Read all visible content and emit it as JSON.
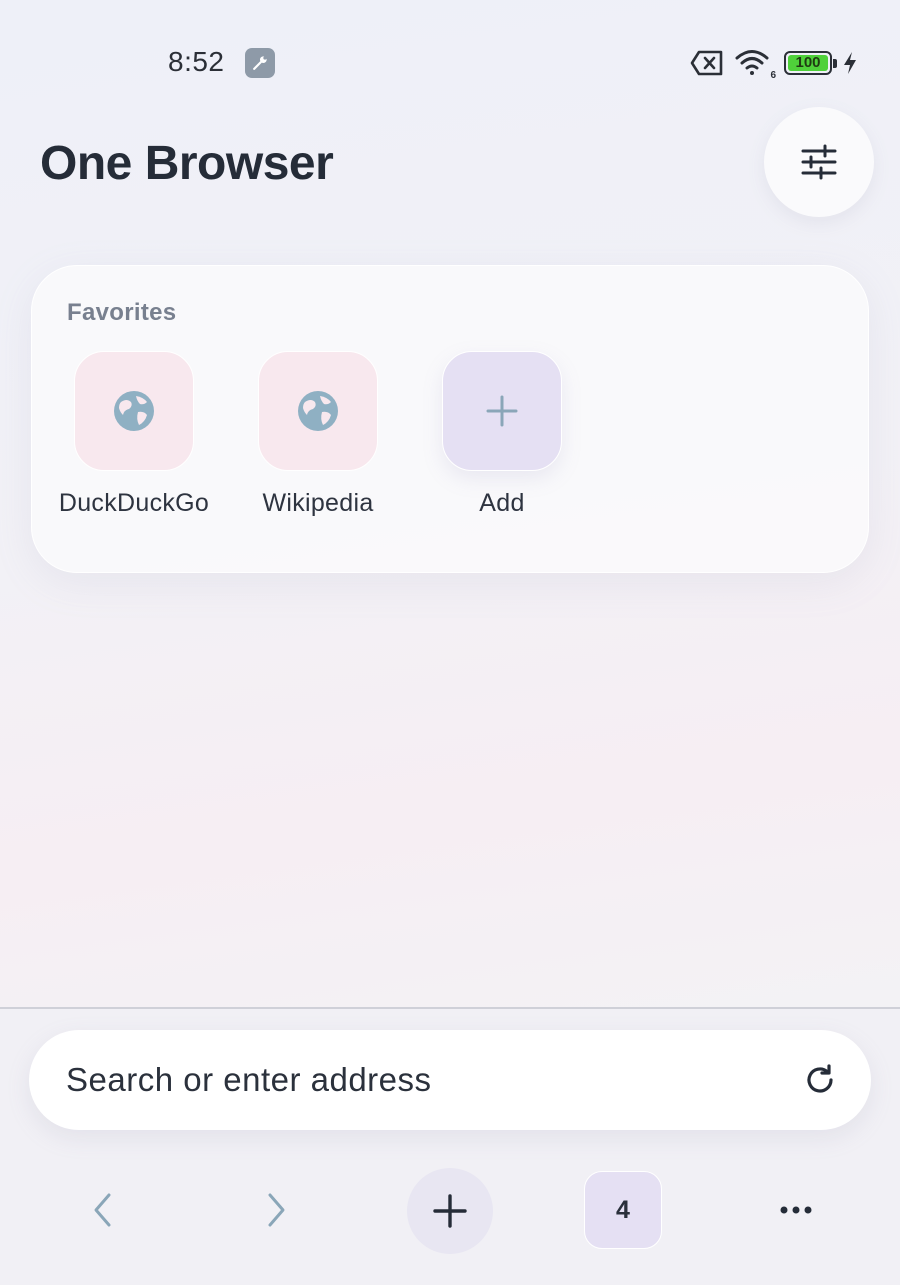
{
  "status_bar": {
    "time": "8:52",
    "battery_level": "100",
    "wifi_standard": "6",
    "icons": [
      "wrench-icon",
      "no-sim-icon",
      "wifi-icon",
      "battery-icon",
      "charging-bolt-icon"
    ],
    "battery_color": "#4fd13a"
  },
  "header": {
    "title": "One Browser",
    "settings_icon": "sliders-icon"
  },
  "favorites": {
    "heading": "Favorites",
    "items": [
      {
        "label": "DuckDuckGo",
        "icon": "globe-icon"
      },
      {
        "label": "Wikipedia",
        "icon": "globe-icon"
      },
      {
        "label": "Add",
        "icon": "plus-icon"
      }
    ]
  },
  "search": {
    "placeholder": "Search or enter address",
    "action_icon": "reload-icon"
  },
  "nav": {
    "back_icon": "chevron-left-icon",
    "forward_icon": "chevron-right-icon",
    "new_tab_icon": "plus-icon",
    "tab_count": "4",
    "menu_icon": "more-horizontal-icon"
  },
  "colors": {
    "title_text": "#252c38",
    "globe_icon": "#8fb0c3",
    "favorite_tile": "#f8e8ee",
    "add_tile": "#e5e0f3",
    "nav_disabled": "#8aa6b8"
  }
}
